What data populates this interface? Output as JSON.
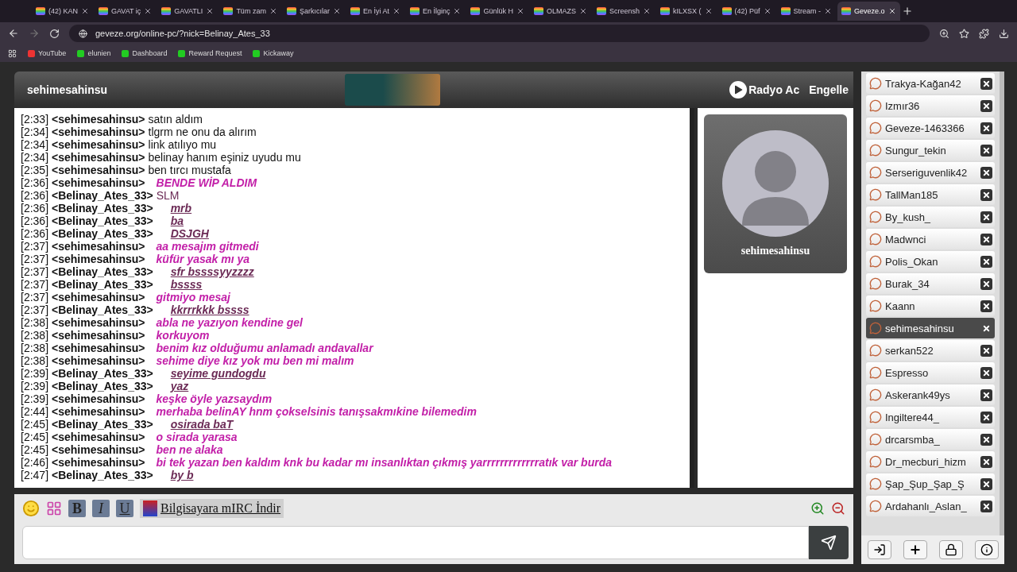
{
  "browser": {
    "tabs": [
      {
        "title": "(42) KAN",
        "selected": false
      },
      {
        "title": "GAVAT iç",
        "selected": false
      },
      {
        "title": "GAVATLI",
        "selected": false
      },
      {
        "title": "Tüm zam",
        "selected": false
      },
      {
        "title": "Şarkıcılar",
        "selected": false
      },
      {
        "title": "En İyi At",
        "selected": false
      },
      {
        "title": "En İlginç",
        "selected": false
      },
      {
        "title": "Günlük H",
        "selected": false
      },
      {
        "title": "OLMAZS",
        "selected": false
      },
      {
        "title": "Screensh",
        "selected": false
      },
      {
        "title": "kILXSX (",
        "selected": false
      },
      {
        "title": "(42) Püf",
        "selected": false
      },
      {
        "title": "Stream -",
        "selected": false
      },
      {
        "title": "Geveze.o",
        "selected": true
      }
    ],
    "url": "geveze.org/online-pc/?nick=Belinay_Ates_33",
    "bookmarks": [
      "YouTube",
      "elunien",
      "Dashboard",
      "Reward Request",
      "Kickaway"
    ]
  },
  "chat": {
    "title": "sehimesahinsu",
    "actions": [
      "Radyo Ac",
      "Engelle"
    ],
    "messages": [
      {
        "time": "[2:33]",
        "nick": "<sehimesahinsu>",
        "text": "satın aldım",
        "kind": "plain"
      },
      {
        "time": "[2:34]",
        "nick": "<sehimesahinsu>",
        "text": "tlgrm ne onu da alırım",
        "kind": "plain"
      },
      {
        "time": "[2:34]",
        "nick": "<sehimesahinsu>",
        "text": "link atılıyo mu",
        "kind": "plain"
      },
      {
        "time": "[2:34]",
        "nick": "<sehimesahinsu>",
        "text": "belinay hanım eşiniz uyudu mu",
        "kind": "plain"
      },
      {
        "time": "[2:35]",
        "nick": "<sehimesahinsu>",
        "text": "ben tırcı mustafa",
        "kind": "plain"
      },
      {
        "time": "[2:36]",
        "nick": "<sehimesahinsu>",
        "text": "BENDE WİP ALDIM",
        "kind": "styled"
      },
      {
        "time": "[2:36]",
        "nick": "<Belinay_Ates_33>",
        "text": "SLM",
        "kind": "colored"
      },
      {
        "time": "[2:36]",
        "nick": "<Belinay_Ates_33>",
        "text": "mrb",
        "kind": "underlined"
      },
      {
        "time": "[2:36]",
        "nick": "<Belinay_Ates_33>",
        "text": "ba",
        "kind": "underlined"
      },
      {
        "time": "[2:36]",
        "nick": "<Belinay_Ates_33>",
        "text": "DSJGH",
        "kind": "underlined"
      },
      {
        "time": "[2:37]",
        "nick": "<sehimesahinsu>",
        "text": "aa mesajım gitmedi",
        "kind": "styled"
      },
      {
        "time": "[2:37]",
        "nick": "<sehimesahinsu>",
        "text": "küfür yasak mı ya",
        "kind": "styled"
      },
      {
        "time": "[2:37]",
        "nick": "<Belinay_Ates_33>",
        "text": "sfr bssssyyzzzz",
        "kind": "underlined"
      },
      {
        "time": "[2:37]",
        "nick": "<Belinay_Ates_33>",
        "text": "bssss",
        "kind": "underlined"
      },
      {
        "time": "[2:37]",
        "nick": "<sehimesahinsu>",
        "text": "gitmiyo mesaj",
        "kind": "styled"
      },
      {
        "time": "[2:37]",
        "nick": "<Belinay_Ates_33>",
        "text": "kkrrrkkk bssss",
        "kind": "underlined"
      },
      {
        "time": "[2:38]",
        "nick": "<sehimesahinsu>",
        "text": "abla ne yazıyon kendine gel",
        "kind": "styled"
      },
      {
        "time": "[2:38]",
        "nick": "<sehimesahinsu>",
        "text": "korkuyom",
        "kind": "styled"
      },
      {
        "time": "[2:38]",
        "nick": "<sehimesahinsu>",
        "text": "benim kız olduğumu anlamadı andavallar",
        "kind": "styled"
      },
      {
        "time": "[2:38]",
        "nick": "<sehimesahinsu>",
        "text": "sehime diye kız yok mu ben mi malım",
        "kind": "styled"
      },
      {
        "time": "[2:39]",
        "nick": "<Belinay_Ates_33>",
        "text": "seyime gundogdu",
        "kind": "underlined"
      },
      {
        "time": "[2:39]",
        "nick": "<Belinay_Ates_33>",
        "text": "yaz",
        "kind": "underlined"
      },
      {
        "time": "[2:39]",
        "nick": "<sehimesahinsu>",
        "text": "keşke öyle yazsaydım",
        "kind": "styled"
      },
      {
        "time": "[2:44]",
        "nick": "<sehimesahinsu>",
        "text": "merhaba belinAY hnm çokselsinis tanışsakmıkine bilemedim",
        "kind": "styled"
      },
      {
        "time": "[2:45]",
        "nick": "<Belinay_Ates_33>",
        "text": "osirada baT",
        "kind": "underlined"
      },
      {
        "time": "[2:45]",
        "nick": "<sehimesahinsu>",
        "text": "o sirada yarasa",
        "kind": "styled"
      },
      {
        "time": "[2:45]",
        "nick": "<sehimesahinsu>",
        "text": "ben ne alaka",
        "kind": "styled"
      },
      {
        "time": "[2:46]",
        "nick": "<sehimesahinsu>",
        "text": "bi tek yazan ben kaldım knk bu kadar mı insanlıktan çıkmış yarrrrrrrrrrrrratık var burda",
        "kind": "styled"
      },
      {
        "time": "[2:47]",
        "nick": "<Belinay_Ates_33>",
        "text": "by b",
        "kind": "underlined"
      }
    ],
    "format_buttons": [
      {
        "label": "B",
        "kind": "bold"
      },
      {
        "label": "I",
        "kind": "italic"
      },
      {
        "label": "U",
        "kind": "underline"
      }
    ],
    "mirc_link": "Bilgisayara mIRC İndir"
  },
  "profile": {
    "name": "sehimesahinsu"
  },
  "users": [
    {
      "name": "Trakya-Kağan42",
      "selected": false
    },
    {
      "name": "Izmır36",
      "selected": false
    },
    {
      "name": "Geveze-1463366",
      "selected": false
    },
    {
      "name": "Sungur_tekin",
      "selected": false
    },
    {
      "name": "Serseriguvenlik42",
      "selected": false
    },
    {
      "name": "TallMan185",
      "selected": false
    },
    {
      "name": "By_kush_",
      "selected": false
    },
    {
      "name": "Madwnci",
      "selected": false
    },
    {
      "name": "Polis_Okan",
      "selected": false
    },
    {
      "name": "Burak_34",
      "selected": false
    },
    {
      "name": "Kaann",
      "selected": false
    },
    {
      "name": "sehimesahinsu",
      "selected": true
    },
    {
      "name": "serkan522",
      "selected": false
    },
    {
      "name": "Espresso",
      "selected": false
    },
    {
      "name": "Askerank49ys",
      "selected": false
    },
    {
      "name": "Ingiltere44_",
      "selected": false
    },
    {
      "name": "drcarsmba_",
      "selected": false
    },
    {
      "name": "Dr_mecburi_hizm",
      "selected": false
    },
    {
      "name": "Şap_Şup_Şap_Ş",
      "selected": false
    },
    {
      "name": "Ardahanlı_Aslan_",
      "selected": false
    }
  ]
}
